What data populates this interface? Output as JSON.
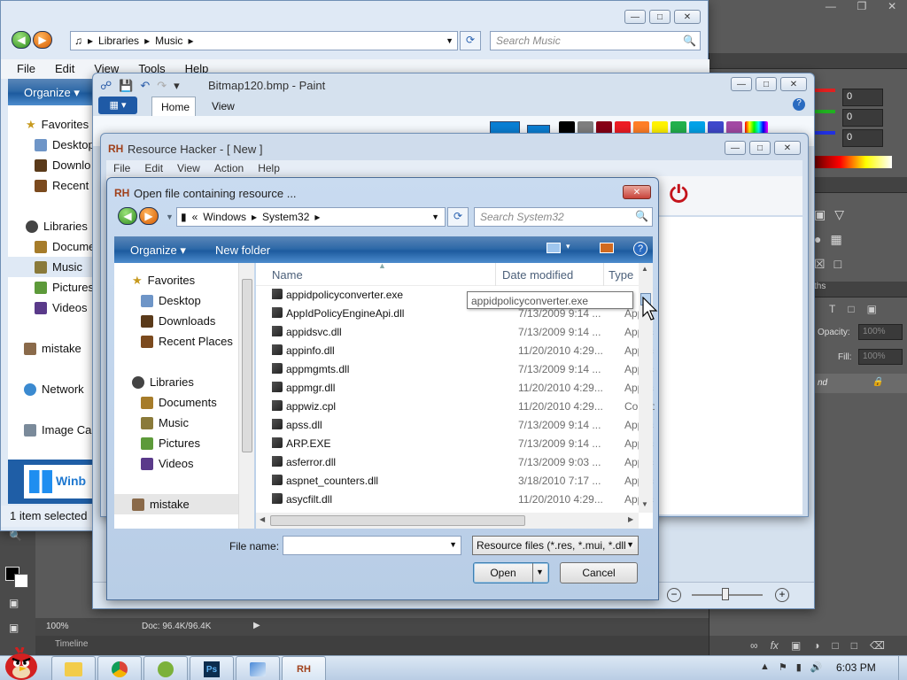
{
  "photoshop": {
    "rgb_labels": [
      "0",
      "0",
      "0"
    ],
    "opacity_label": "Opacity:",
    "opacity_value": "100%",
    "fill_label": "Fill:",
    "fill_value": "100%",
    "panel_tab": "ths",
    "layer_name": "nd",
    "zoom": "100%",
    "doc_info": "Doc: 96.4K/96.4K",
    "timeline": "Timeline"
  },
  "explorer": {
    "breadcrumb": [
      "Libraries",
      "Music"
    ],
    "search_placeholder": "Search Music",
    "menu": [
      "File",
      "Edit",
      "View",
      "Tools",
      "Help"
    ],
    "organize": "Organize",
    "nav": {
      "favorites": "Favorites",
      "desktop": "Desktop",
      "downloads": "Downlo",
      "recent": "Recent",
      "libraries": "Libraries",
      "documents": "Docume",
      "music": "Music",
      "pictures": "Pictures",
      "videos": "Videos",
      "mistake": "mistake",
      "network": "Network",
      "imagecap": "Image Ca"
    },
    "status": "1 item selected",
    "banner": "Winb"
  },
  "paint": {
    "title": "Bitmap120.bmp - Paint",
    "tabs": [
      "Home",
      "View"
    ]
  },
  "reshacker": {
    "title": "Resource Hacker - [ New ]",
    "menu": [
      "File",
      "Edit",
      "View",
      "Action",
      "Help"
    ]
  },
  "dialog": {
    "title": "Open file containing resource ...",
    "breadcrumb_prefix": "«",
    "breadcrumb": [
      "Windows",
      "System32"
    ],
    "search_placeholder": "Search System32",
    "organize": "Organize",
    "new_folder": "New folder",
    "nav": {
      "favorites": "Favorites",
      "desktop": "Desktop",
      "downloads": "Downloads",
      "recent": "Recent Places",
      "libraries": "Libraries",
      "documents": "Documents",
      "music": "Music",
      "pictures": "Pictures",
      "videos": "Videos",
      "mistake": "mistake"
    },
    "columns": {
      "name": "Name",
      "date": "Date modified",
      "type": "Type"
    },
    "files": [
      {
        "name": "appidpolicyconverter.exe",
        "date": "",
        "type": ""
      },
      {
        "name": "AppIdPolicyEngineApi.dll",
        "date": "7/13/2009 9:14 ...",
        "type": "Applic"
      },
      {
        "name": "appidsvc.dll",
        "date": "7/13/2009 9:14 ...",
        "type": "Applic"
      },
      {
        "name": "appinfo.dll",
        "date": "11/20/2010 4:29...",
        "type": "Applic"
      },
      {
        "name": "appmgmts.dll",
        "date": "7/13/2009 9:14 ...",
        "type": "Applic"
      },
      {
        "name": "appmgr.dll",
        "date": "11/20/2010 4:29...",
        "type": "Applic"
      },
      {
        "name": "appwiz.cpl",
        "date": "11/20/2010 4:29...",
        "type": "Contro"
      },
      {
        "name": "apss.dll",
        "date": "7/13/2009 9:14 ...",
        "type": "Applic"
      },
      {
        "name": "ARP.EXE",
        "date": "7/13/2009 9:14 ...",
        "type": "Applic"
      },
      {
        "name": "asferror.dll",
        "date": "7/13/2009 9:03 ...",
        "type": "Applic"
      },
      {
        "name": "aspnet_counters.dll",
        "date": "3/18/2010 7:17 ...",
        "type": "Applic"
      },
      {
        "name": "asycfilt.dll",
        "date": "11/20/2010 4:29...",
        "type": "Applic"
      }
    ],
    "tooltip": "appidpolicyconverter.exe",
    "filename_label": "File name:",
    "filename_value": "",
    "filetype": "Resource files (*.res, *.mui, *.dll",
    "open": "Open",
    "cancel": "Cancel"
  },
  "taskbar": {
    "clock": "6:03 PM",
    "ps_label": "Ps",
    "rh_label": "RH"
  },
  "colors": {
    "ps_bg": "#5a5a5a",
    "cmdbar": "#2f6aa8",
    "taskbar": "#c3d5ea",
    "close_red": "#c8423a"
  }
}
